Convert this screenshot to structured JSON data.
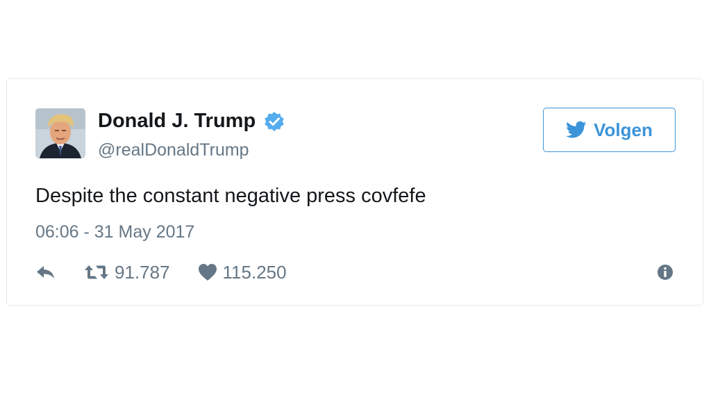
{
  "tweet": {
    "author": {
      "display_name": "Donald J. Trump",
      "handle": "@realDonaldTrump",
      "verified": true
    },
    "follow_label": "Volgen",
    "text": "Despite the constant negative press covfefe",
    "timestamp": "06:06 - 31 May 2017",
    "stats": {
      "retweets": "91.787",
      "likes": "115.250"
    }
  },
  "icons": {
    "verified": "verified-badge-icon",
    "follow": "twitter-bird-icon",
    "reply": "reply-icon",
    "retweet": "retweet-icon",
    "like": "heart-icon",
    "info": "info-icon"
  },
  "colors": {
    "twitter_blue": "#3b94d9",
    "verified_blue": "#55acee",
    "text_primary": "#14171a",
    "text_secondary": "#657786",
    "border": "#e1e8ed"
  }
}
